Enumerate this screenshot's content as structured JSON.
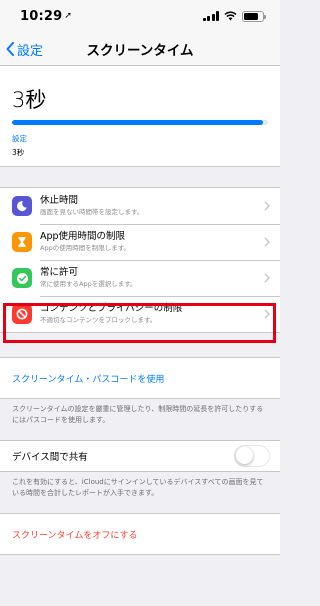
{
  "status_bar": {
    "time": "10:29"
  },
  "nav": {
    "back_label": "設定",
    "title": "スクリーンタイム"
  },
  "usage": {
    "total": "3秒",
    "bar_fill_fraction": 0.98,
    "legend_label": "設定",
    "legend_value": "3秒",
    "bar_color": "#007aff"
  },
  "menu": {
    "items": [
      {
        "title": "休止時間",
        "subtitle": "画面を見ない時間帯を設定します。",
        "icon": "downtime-icon",
        "color": "#5856d6"
      },
      {
        "title": "App使用時間の制限",
        "subtitle": "Appの使用時間を制限します。",
        "icon": "hourglass-icon",
        "color": "#ff9500"
      },
      {
        "title": "常に許可",
        "subtitle": "常に使用するAppを選択します。",
        "icon": "checkmark-seal-icon",
        "color": "#34c759"
      },
      {
        "title": "コンテンツとプライバシーの制限",
        "subtitle": "不適切なコンテンツをブロックします。",
        "icon": "restriction-icon",
        "color": "#ff3b30"
      }
    ]
  },
  "passcode": {
    "link_label": "スクリーンタイム・パスコードを使用",
    "footnote": "スクリーンタイムの設定を厳重に管理したり、制限時間の延長を許可したりするにはパスコードを使用します。"
  },
  "share": {
    "label": "デバイス間で共有",
    "enabled": false,
    "footnote": "これを有効にすると、iCloudにサインインしているデバイスすべての画面を見ている時間を合計したレポートが入手できます。"
  },
  "turn_off": {
    "label": "スクリーンタイムをオフにする",
    "color": "#ff3b30"
  }
}
